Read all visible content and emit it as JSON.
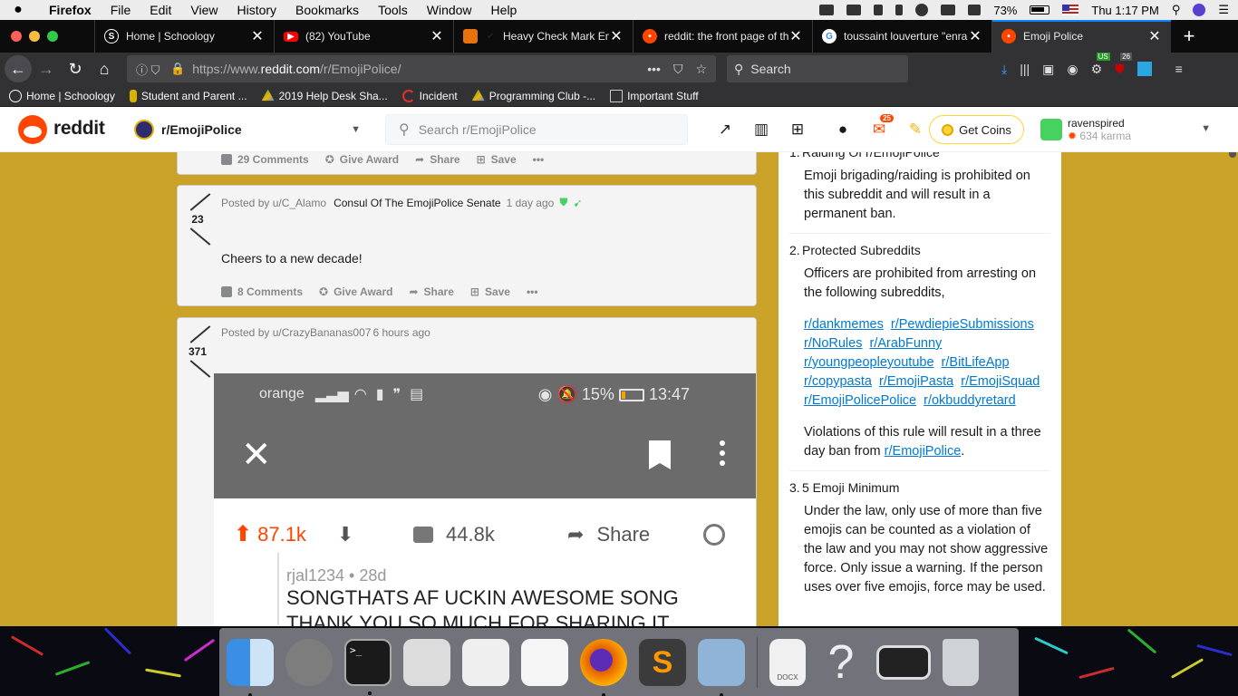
{
  "menubar": {
    "apple": "",
    "app": "Firefox",
    "items": [
      "File",
      "Edit",
      "View",
      "History",
      "Bookmarks",
      "Tools",
      "Window",
      "Help"
    ],
    "battery": "73%",
    "clock": "Thu 1:17 PM"
  },
  "tabs": [
    {
      "title": "Home | Schoology",
      "favicon": "schoology-icon",
      "color": "#1d4f8c"
    },
    {
      "title": "(82) YouTube",
      "favicon": "youtube-icon",
      "color": "#ff0000"
    },
    {
      "title": "Heavy Check Mark Em",
      "favicon": "emojipedia-icon",
      "color": "#e8730c"
    },
    {
      "title": "reddit: the front page of th",
      "favicon": "reddit-icon",
      "color": "#ff4500"
    },
    {
      "title": "toussaint louverture \"enra",
      "favicon": "google-icon",
      "color": "#ffffff"
    },
    {
      "title": "Emoji Police",
      "favicon": "reddit-icon",
      "color": "#ff4500",
      "active": true
    }
  ],
  "nav": {
    "url_prefix": "https://www.",
    "url_host": "reddit.com",
    "url_path": "/r/EmojiPolice/",
    "search_placeholder": "Search",
    "ext_badge_us": "US",
    "ext_badge_count": "26"
  },
  "bookmarks": [
    {
      "label": "Home | Schoology",
      "icon": "schoology-icon",
      "color": "#1d4f8c"
    },
    {
      "label": "Student and Parent ...",
      "icon": "parent-portal-icon",
      "color": "#d4b400"
    },
    {
      "label": "2019 Help Desk Sha...",
      "icon": "google-drive-icon",
      "color": "#f4b400"
    },
    {
      "label": "Incident",
      "icon": "incident-icon",
      "color": "#e03030"
    },
    {
      "label": "Programming Club -...",
      "icon": "google-drive-icon",
      "color": "#f4b400"
    },
    {
      "label": "Important Stuff",
      "icon": "folder-icon",
      "color": "#cccccc"
    }
  ],
  "reddit_header": {
    "wordmark": "reddit",
    "subreddit": "r/EmojiPolice",
    "search_placeholder": "Search r/EmojiPolice",
    "chat_badge": "25",
    "coins_label": "Get Coins",
    "username": "ravenspired",
    "karma": "634 karma"
  },
  "posts": [
    {
      "comments": "29 Comments",
      "award": "Give Award",
      "share": "Share",
      "save": "Save",
      "more": "•••"
    },
    {
      "score": "23",
      "author": "Posted by u/C_Alamo",
      "flair": "Consul Of The EmojiPolice Senate",
      "time": "1 day ago",
      "body": "Cheers to a new decade!",
      "comments": "8 Comments",
      "award": "Give Award",
      "share": "Share",
      "save": "Save",
      "more": "•••"
    },
    {
      "score": "371",
      "author": "Posted by u/CrazyBananas007",
      "time": "6 hours ago",
      "image": {
        "carrier": "orange",
        "status_right": "15%",
        "clock": "13:47",
        "upvotes": "87.1k",
        "comments": "44.8k",
        "share": "Share",
        "comment_user": "rjal1234 • 28d",
        "comment_line1": "SONGTHATS AF UCKIN AWESOME  SONG",
        "comment_line2": "THANK YOU SO MUCH FOR SHARING IT"
      }
    }
  ],
  "rules": [
    {
      "num": "1.",
      "title": "Raiding Of r/EmojiPolice",
      "desc": "Emoji brigading/raiding is prohibited on this subreddit and will result in a permanent ban."
    },
    {
      "num": "2.",
      "title": "Protected Subreddits",
      "desc": "Officers are prohibited from arresting on the following subreddits,",
      "links": [
        "r/dankmemes",
        "r/PewdiepieSubmissions",
        "r/NoRules",
        "r/ArabFunny",
        "r/youngpeopleyoutube",
        "r/BitLifeApp",
        "r/copypasta",
        "r/EmojiPasta",
        "r/EmojiSquad",
        "r/EmojiPolicePolice",
        "r/okbuddyretard"
      ],
      "footer_text": "Violations of this rule will result in a three day ban from ",
      "footer_link": "r/EmojiPolice",
      "footer_end": "."
    },
    {
      "num": "3.",
      "title": "5 Emoji Minimum",
      "desc": "Under the law, only use of more than five emojis can be counted as a violation of the law and you may not show aggressive force. Only issue a warning. If the person uses over five emojis, force may be used."
    }
  ],
  "dock": [
    {
      "name": "finder-icon",
      "color": "#3a8ee6",
      "running": true
    },
    {
      "name": "system-preferences-icon",
      "color": "#7d7d7d",
      "running": false
    },
    {
      "name": "terminal-icon",
      "color": "#1a1a1a",
      "running": true
    },
    {
      "name": "script-editor-icon",
      "color": "#dcdcdc",
      "running": false
    },
    {
      "name": "textedit-icon",
      "color": "#efefef",
      "running": false
    },
    {
      "name": "notes-icon",
      "color": "#f5f5f5",
      "running": false
    },
    {
      "name": "firefox-icon",
      "color": "#e66000",
      "running": true
    },
    {
      "name": "sublime-text-icon",
      "color": "#3b3b3b",
      "running": false
    },
    {
      "name": "preview-icon",
      "color": "#8fb4d8",
      "running": true
    },
    {
      "name": "docx-file-icon",
      "color": "#f0f0f0",
      "label": "DOCX",
      "running": false
    },
    {
      "name": "help-icon",
      "color": "transparent",
      "running": false
    },
    {
      "name": "screenshot-window-icon",
      "color": "#222222",
      "running": false
    },
    {
      "name": "trash-icon",
      "color": "#cfd3d6",
      "running": false
    }
  ]
}
